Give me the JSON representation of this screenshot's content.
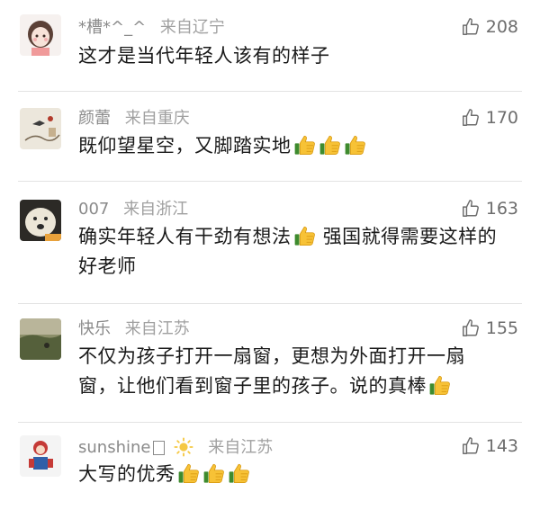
{
  "comments": [
    {
      "username": "*槽*^_^",
      "location": "来自辽宁",
      "likes": "208",
      "text": "这才是当代年轻人该有的样子",
      "emojis": []
    },
    {
      "username": "颜蕾",
      "location": "来自重庆",
      "likes": "170",
      "text": "既仰望星空，又脚踏实地",
      "emojis": [
        "thumbs-up",
        "thumbs-up",
        "thumbs-up"
      ]
    },
    {
      "username": "007",
      "location": "来自浙江",
      "likes": "163",
      "text_a": "确实年轻人有干劲有想法",
      "text_b": "强国就得需要这样的好老师",
      "emojis": [
        "thumbs-up"
      ]
    },
    {
      "username": "快乐",
      "location": "来自江苏",
      "likes": "155",
      "text": "不仅为孩子打开一扇窗，更想为外面打开一扇窗，让他们看到窗子里的孩子。说的真棒",
      "emojis": [
        "thumbs-up"
      ]
    },
    {
      "username": "sunshine",
      "location": "来自江苏",
      "likes": "143",
      "text": "大写的优秀",
      "emojis": [
        "thumbs-up",
        "thumbs-up",
        "thumbs-up"
      ]
    }
  ],
  "icons": {
    "like": "thumb-up-outline-icon",
    "emoji": "thumbs-up-emoji",
    "sun": "sun-emoji"
  },
  "colors": {
    "username": "#8a8a8a",
    "text": "#1a1a1a",
    "divider": "#e3e3e3",
    "likes": "#6d6d6d"
  }
}
